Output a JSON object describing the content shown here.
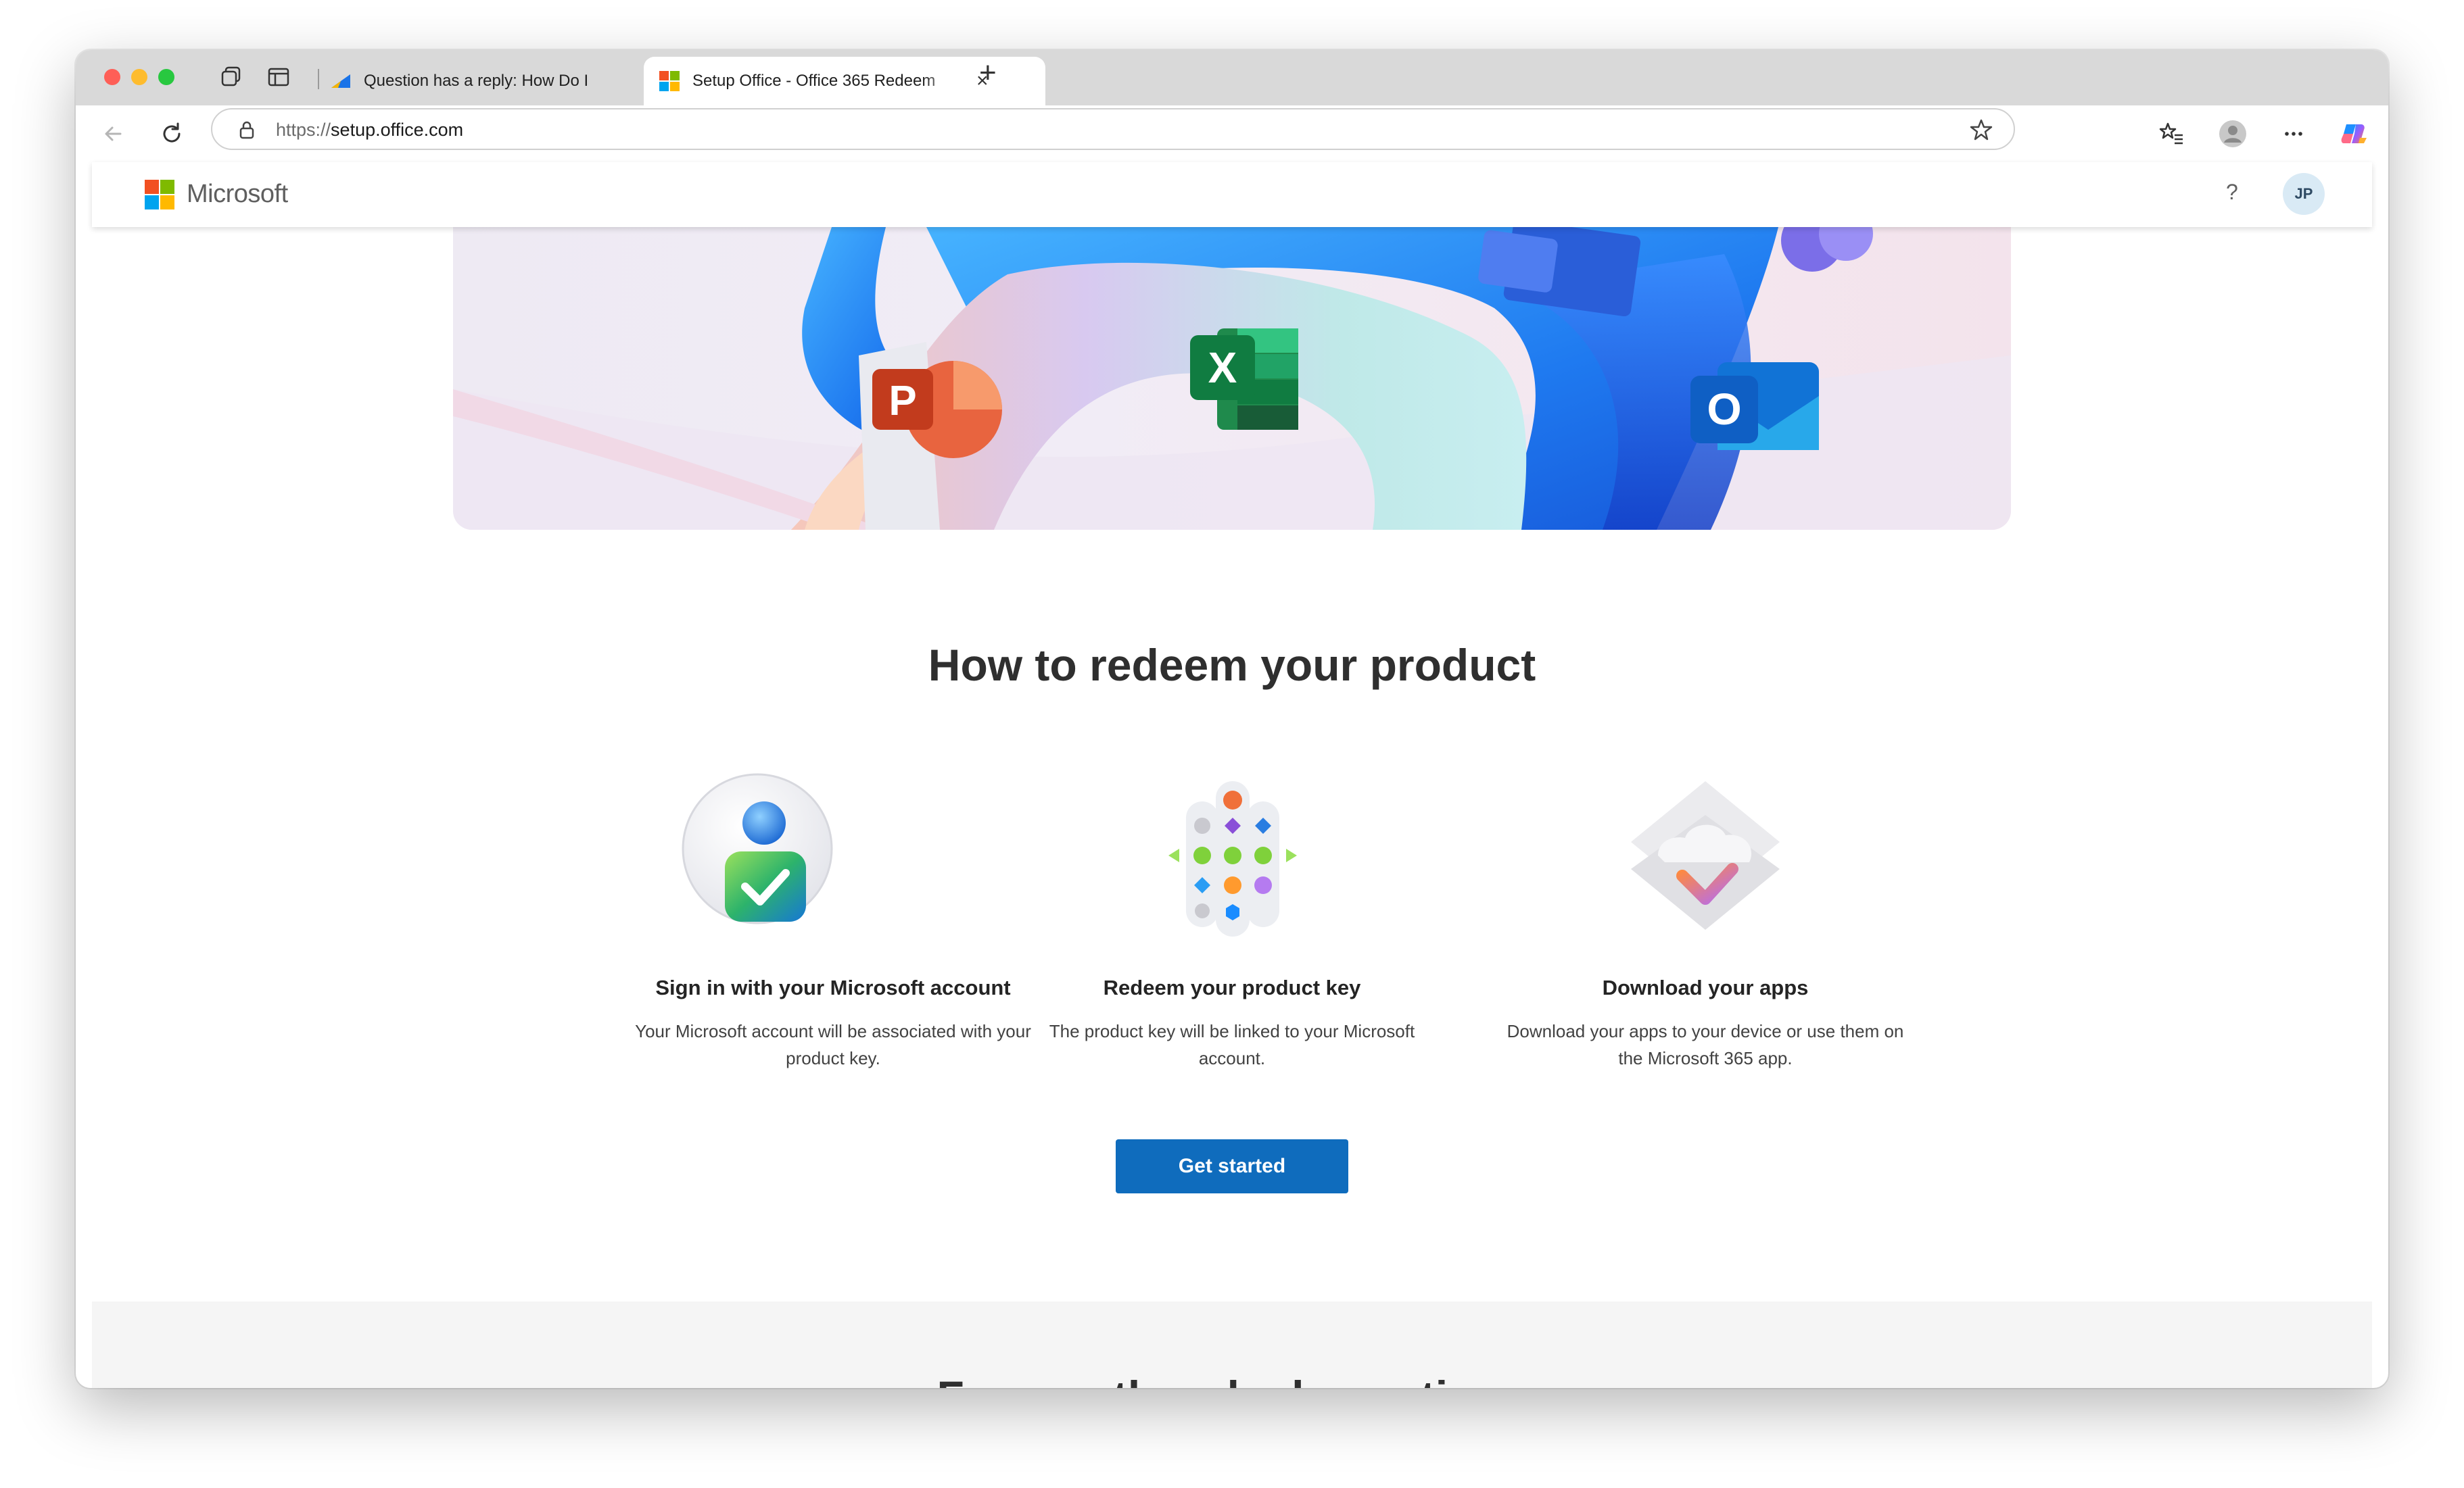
{
  "browser": {
    "tabs": [
      {
        "title": "Question has a reply: How Do I",
        "active": false
      },
      {
        "title": "Setup Office - Office 365 Redeem",
        "active": true
      }
    ],
    "address": {
      "scheme": "https://",
      "host": "setup.office.com"
    }
  },
  "site": {
    "brand": "Microsoft",
    "help_label": "?",
    "avatar_initials": "JP"
  },
  "main": {
    "heading": "How to redeem your product",
    "steps": [
      {
        "title": "Sign in with your Microsoft account",
        "description": "Your Microsoft account will be associated with your product key."
      },
      {
        "title": "Redeem your product key",
        "description": "The product key will be linked to your Microsoft account."
      },
      {
        "title": "Download your apps",
        "description": "Download your apps to your device or use them on the Microsoft 365 app."
      }
    ],
    "cta_label": "Get started",
    "next_section_heading": "Frequently asked questions"
  },
  "colors": {
    "accent": "#0f6cbd",
    "ms_red": "#f25022",
    "ms_green": "#7fba00",
    "ms_blue": "#00a4ef",
    "ms_yellow": "#ffb900"
  }
}
